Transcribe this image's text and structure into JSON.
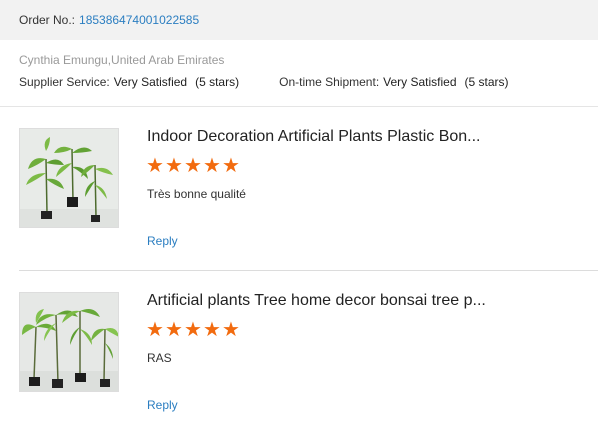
{
  "order": {
    "label": "Order No.:",
    "number": "185386474001022585"
  },
  "buyer": {
    "name": "Cynthia Emungu,United Arab Emirates",
    "supplier_service": {
      "label": "Supplier Service:",
      "value": "Very Satisfied",
      "stars": "(5 stars)"
    },
    "ontime_shipment": {
      "label": "On-time Shipment:",
      "value": "Very Satisfied",
      "stars": "(5 stars)"
    }
  },
  "reviews": [
    {
      "title": "Indoor Decoration Artificial Plants Plastic Bon...",
      "rating": 5,
      "comment": "Très bonne qualité",
      "reply_label": "Reply"
    },
    {
      "title": "Artificial plants Tree home decor bonsai tree p...",
      "rating": 5,
      "comment": "RAS",
      "reply_label": "Reply"
    }
  ],
  "colors": {
    "accent_link": "#2b7ec1",
    "star": "#f26b0f",
    "order_bar_bg": "#f2f2f2"
  },
  "icons": {
    "star": "star-icon"
  }
}
